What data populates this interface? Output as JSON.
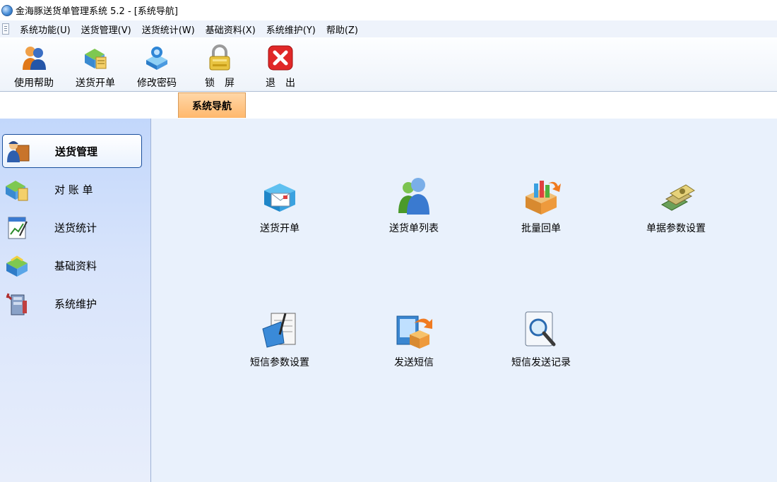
{
  "window": {
    "title": "金海豚送货单管理系统 5.2 - [系统导航]",
    "icon": "app-globe-icon"
  },
  "menubar": {
    "items": [
      {
        "label": "系统功能(U)"
      },
      {
        "label": "送货管理(V)"
      },
      {
        "label": "送货统计(W)"
      },
      {
        "label": "基础资料(X)"
      },
      {
        "label": "系统维护(Y)"
      },
      {
        "label": "帮助(Z)"
      }
    ]
  },
  "toolbar": {
    "buttons": [
      {
        "label": "使用帮助",
        "icon": "user-help-icon"
      },
      {
        "label": "送货开单",
        "icon": "delivery-order-icon"
      },
      {
        "label": "修改密码",
        "icon": "change-password-icon"
      },
      {
        "label": "锁　屏",
        "icon": "lock-icon"
      },
      {
        "label": "退　出",
        "icon": "exit-icon"
      }
    ]
  },
  "tabs": {
    "active": "系统导航"
  },
  "sidebar": {
    "items": [
      {
        "label": "送货管理",
        "icon": "delivery-man-icon",
        "selected": true
      },
      {
        "label": "对 账 单",
        "icon": "statement-icon",
        "selected": false
      },
      {
        "label": "送货统计",
        "icon": "statistics-icon",
        "selected": false
      },
      {
        "label": "基础资料",
        "icon": "basic-data-icon",
        "selected": false
      },
      {
        "label": "系统维护",
        "icon": "system-maintenance-icon",
        "selected": false
      }
    ]
  },
  "nav": {
    "items": [
      {
        "label": "送货开单",
        "icon": "envelope-box-icon"
      },
      {
        "label": "送货单列表",
        "icon": "people-list-icon"
      },
      {
        "label": "批量回单",
        "icon": "batch-return-icon"
      },
      {
        "label": "单据参数设置",
        "icon": "document-settings-icon"
      },
      {
        "label": "短信参数设置",
        "icon": "sms-settings-icon"
      },
      {
        "label": "发送短信",
        "icon": "send-sms-icon"
      },
      {
        "label": "短信发送记录",
        "icon": "sms-log-search-icon"
      }
    ]
  },
  "colors": {
    "sidebar_gradient_top": "#c2d7fb",
    "main_background": "#e9f1fc",
    "tab_active": "#ffb86c",
    "selected_border": "#1a4f9c"
  }
}
